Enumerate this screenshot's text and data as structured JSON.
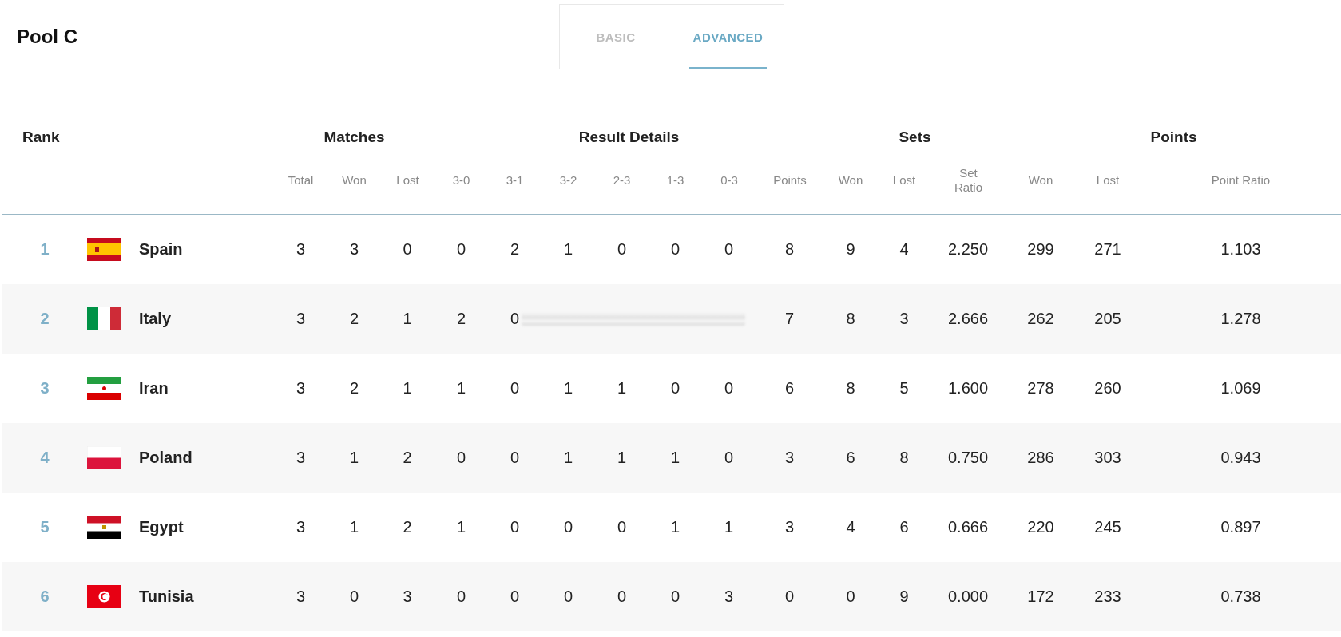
{
  "title": "Pool C",
  "tabs": [
    {
      "label": "BASIC",
      "selected": false
    },
    {
      "label": "ADVANCED",
      "selected": true
    }
  ],
  "rank_header": "Rank",
  "groups": [
    {
      "label": "Matches",
      "columns": [
        "Total",
        "Won",
        "Lost"
      ]
    },
    {
      "label": "Result Details",
      "columns": [
        "3-0",
        "3-1",
        "3-2",
        "2-3",
        "1-3",
        "0-3",
        "Points"
      ]
    },
    {
      "label": "Sets",
      "columns": [
        "Won",
        "Lost",
        "Set Ratio"
      ]
    },
    {
      "label": "Points",
      "columns": [
        "Won",
        "Lost",
        "Point Ratio"
      ]
    }
  ],
  "rows": [
    {
      "rank": "1",
      "kind": "spain",
      "country": "Spain",
      "matches": [
        "3",
        "3",
        "0"
      ],
      "results": [
        "0",
        "2",
        "1",
        "0",
        "0",
        "0"
      ],
      "result_points": "8",
      "sets": [
        "9",
        "4",
        "2.250"
      ],
      "points": [
        "299",
        "271",
        "1.103"
      ]
    },
    {
      "rank": "2",
      "kind": "italy",
      "country": "Italy",
      "matches": [
        "3",
        "2",
        "1"
      ],
      "results": [
        "2",
        "0"
      ],
      "result_points": "7",
      "sets": [
        "8",
        "3",
        "2.666"
      ],
      "points": [
        "262",
        "205",
        "1.278"
      ]
    },
    {
      "rank": "3",
      "kind": "iran",
      "country": "Iran",
      "matches": [
        "3",
        "2",
        "1"
      ],
      "results": [
        "1",
        "0",
        "1",
        "1",
        "0",
        "0"
      ],
      "result_points": "6",
      "sets": [
        "8",
        "5",
        "1.600"
      ],
      "points": [
        "278",
        "260",
        "1.069"
      ]
    },
    {
      "rank": "4",
      "kind": "poland",
      "country": "Poland",
      "matches": [
        "3",
        "1",
        "2"
      ],
      "results": [
        "0",
        "0",
        "1",
        "1",
        "1",
        "0"
      ],
      "result_points": "3",
      "sets": [
        "6",
        "8",
        "0.750"
      ],
      "points": [
        "286",
        "303",
        "0.943"
      ]
    },
    {
      "rank": "5",
      "kind": "egypt",
      "country": "Egypt",
      "matches": [
        "3",
        "1",
        "2"
      ],
      "results": [
        "1",
        "0",
        "0",
        "0",
        "1",
        "1"
      ],
      "result_points": "3",
      "sets": [
        "4",
        "6",
        "0.666"
      ],
      "points": [
        "220",
        "245",
        "0.897"
      ]
    },
    {
      "rank": "6",
      "kind": "tunisia",
      "country": "Tunisia",
      "matches": [
        "3",
        "0",
        "3"
      ],
      "results": [
        "0",
        "0",
        "0",
        "0",
        "0",
        "3"
      ],
      "result_points": "0",
      "sets": [
        "0",
        "9",
        "0.000"
      ],
      "points": [
        "172",
        "233",
        "0.738"
      ]
    }
  ]
}
